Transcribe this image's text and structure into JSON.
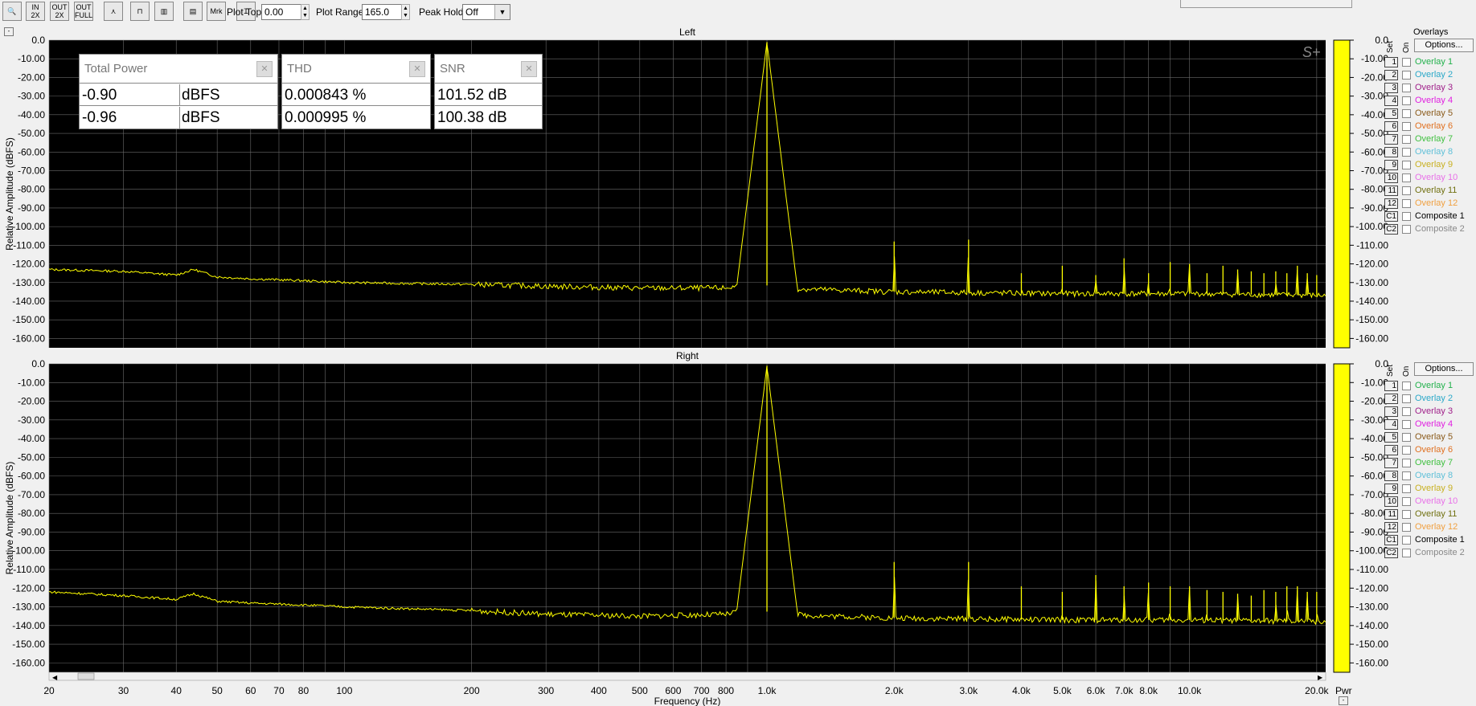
{
  "toolbar": {
    "buttons": [
      {
        "name": "zoom-button",
        "label": "🔍"
      },
      {
        "name": "zoom-in-2x-button",
        "label": "IN 2X"
      },
      {
        "name": "zoom-out-2x-button",
        "label": "OUT 2X"
      },
      {
        "name": "zoom-out-full-button",
        "label": "OUT FULL"
      },
      {
        "name": "line-plot-button",
        "label": "⋏"
      },
      {
        "name": "step-plot-button",
        "label": "⊓"
      },
      {
        "name": "bar-plot-button",
        "label": "▥"
      },
      {
        "name": "display-button",
        "label": "▤"
      },
      {
        "name": "marker-button",
        "label": "Mrk"
      },
      {
        "name": "vertical-scale-button",
        "label": "Ɪ"
      }
    ],
    "plot_top_label": "Plot Top:",
    "plot_top_value": "0.00",
    "plot_range_label": "Plot Range:",
    "plot_range_value": "165.0",
    "peak_hold_label": "Peak Hold:",
    "peak_hold_value": "Off"
  },
  "stats": {
    "total_power": {
      "title": "Total Power",
      "rows": [
        {
          "value": "-0.90",
          "unit": "dBFS"
        },
        {
          "value": "-0.96",
          "unit": "dBFS"
        }
      ]
    },
    "thd": {
      "title": "THD",
      "rows": [
        {
          "value": "0.000843 %"
        },
        {
          "value": "0.000995 %"
        }
      ]
    },
    "snr": {
      "title": "SNR",
      "rows": [
        {
          "value": "101.52 dB"
        },
        {
          "value": "100.38 dB"
        }
      ]
    }
  },
  "logo_text": "S+",
  "meter_label": "Pwr",
  "overlays": {
    "title": "Overlays",
    "set_label": "Set",
    "on_label": "On",
    "options_label": "Options...",
    "items": [
      {
        "set": "1",
        "name": "Overlay 1",
        "color": "#22b14c"
      },
      {
        "set": "2",
        "name": "Overlay 2",
        "color": "#2aa8c8"
      },
      {
        "set": "3",
        "name": "Overlay 3",
        "color": "#a0208a"
      },
      {
        "set": "4",
        "name": "Overlay 4",
        "color": "#e020e0"
      },
      {
        "set": "5",
        "name": "Overlay 5",
        "color": "#8a5a1a"
      },
      {
        "set": "6",
        "name": "Overlay 6",
        "color": "#e07020"
      },
      {
        "set": "7",
        "name": "Overlay 7",
        "color": "#40c040"
      },
      {
        "set": "8",
        "name": "Overlay 8",
        "color": "#60c0d8"
      },
      {
        "set": "9",
        "name": "Overlay 9",
        "color": "#c8b020"
      },
      {
        "set": "10",
        "name": "Overlay 10",
        "color": "#e870e8"
      },
      {
        "set": "11",
        "name": "Overlay 11",
        "color": "#707010"
      },
      {
        "set": "12",
        "name": "Overlay 12",
        "color": "#f0a040"
      },
      {
        "set": "C1",
        "name": "Composite 1",
        "color": "#000000"
      },
      {
        "set": "C2",
        "name": "Composite 2",
        "color": "#888888"
      }
    ]
  },
  "chart_data": [
    {
      "type": "line",
      "title": "Left",
      "xlabel": "Frequency (Hz)",
      "ylabel": "Relative Amplitude (dBFS)",
      "x_scale": "log",
      "xlim": [
        20,
        21000
      ],
      "ylim": [
        -165,
        0
      ],
      "x_ticks": [
        20,
        30,
        40,
        50,
        60,
        70,
        80,
        100,
        200,
        300,
        400,
        500,
        600,
        700,
        800,
        1000,
        2000,
        3000,
        4000,
        5000,
        6000,
        7000,
        8000,
        10000,
        20000
      ],
      "x_tick_labels": [
        "20",
        "30",
        "40",
        "50",
        "60",
        "70",
        "80",
        "100",
        "200",
        "300",
        "400",
        "500",
        "600",
        "700",
        "800",
        "1.0k",
        "2.0k",
        "3.0k",
        "4.0k",
        "5.0k",
        "6.0k",
        "7.0k",
        "8.0k",
        "10.0k",
        "20.0k"
      ],
      "y_ticks": [
        0,
        -10,
        -20,
        -30,
        -40,
        -50,
        -60,
        -70,
        -80,
        -90,
        -100,
        -110,
        -120,
        -130,
        -140,
        -150,
        -160
      ],
      "y_tick_labels": [
        "0.0",
        "-10.00",
        "-20.00",
        "-30.00",
        "-40.00",
        "-50.00",
        "-60.00",
        "-70.00",
        "-80.00",
        "-90.00",
        "-100.00",
        "-110.00",
        "-120.00",
        "-130.00",
        "-140.00",
        "-150.00",
        "-160.00"
      ],
      "grid": true,
      "series": [
        {
          "color": "#ffff00",
          "noise_floor": {
            "x": [
              20,
              30,
              40,
              44,
              50,
              60,
              80,
              100,
              200,
              300,
              500,
              800,
              950,
              1050,
              2000,
              5000,
              10000,
              21000
            ],
            "y": [
              -123,
              -124,
              -126,
              -123,
              -127,
              -128,
              -129,
              -130,
              -131,
              -132,
              -133,
              -133,
              -130,
              -133,
              -135,
              -136,
              -136,
              -137
            ]
          },
          "peaks": {
            "x": [
              1000,
              2000,
              3000,
              4000,
              5000,
              6000,
              7000,
              8000,
              9000,
              10000,
              11000,
              12000,
              13000,
              14000,
              15000,
              16000,
              17000,
              18000,
              19000,
              20000
            ],
            "y": [
              -1,
              -108,
              -107,
              -125,
              -121,
              -126,
              -117,
              -125,
              -119,
              -120,
              -125,
              -121,
              -123,
              -124,
              -125,
              -124,
              -125,
              -121,
              -125,
              -126
            ]
          }
        }
      ]
    },
    {
      "type": "line",
      "title": "Right",
      "xlabel": "Frequency (Hz)",
      "ylabel": "Relative Amplitude (dBFS)",
      "x_scale": "log",
      "xlim": [
        20,
        21000
      ],
      "ylim": [
        -165,
        0
      ],
      "x_ticks": [
        20,
        30,
        40,
        50,
        60,
        70,
        80,
        100,
        200,
        300,
        400,
        500,
        600,
        700,
        800,
        1000,
        2000,
        3000,
        4000,
        5000,
        6000,
        7000,
        8000,
        10000,
        20000
      ],
      "x_tick_labels": [
        "20",
        "30",
        "40",
        "50",
        "60",
        "70",
        "80",
        "100",
        "200",
        "300",
        "400",
        "500",
        "600",
        "700",
        "800",
        "1.0k",
        "2.0k",
        "3.0k",
        "4.0k",
        "5.0k",
        "6.0k",
        "7.0k",
        "8.0k",
        "10.0k",
        "20.0k"
      ],
      "y_ticks": [
        0,
        -10,
        -20,
        -30,
        -40,
        -50,
        -60,
        -70,
        -80,
        -90,
        -100,
        -110,
        -120,
        -130,
        -140,
        -150,
        -160
      ],
      "y_tick_labels": [
        "0.0",
        "-10.00",
        "-20.00",
        "-30.00",
        "-40.00",
        "-50.00",
        "-60.00",
        "-70.00",
        "-80.00",
        "-90.00",
        "-100.00",
        "-110.00",
        "-120.00",
        "-130.00",
        "-140.00",
        "-150.00",
        "-160.00"
      ],
      "grid": true,
      "series": [
        {
          "color": "#ffff00",
          "noise_floor": {
            "x": [
              20,
              30,
              40,
              44,
              50,
              60,
              80,
              100,
              200,
              300,
              500,
              800,
              950,
              1050,
              2000,
              5000,
              10000,
              21000
            ],
            "y": [
              -122,
              -124,
              -126,
              -123,
              -127,
              -128,
              -129,
              -130,
              -132,
              -134,
              -135,
              -134,
              -131,
              -134,
              -136,
              -137,
              -137,
              -138
            ]
          },
          "peaks": {
            "x": [
              1000,
              2000,
              3000,
              4000,
              5000,
              6000,
              7000,
              8000,
              9000,
              10000,
              11000,
              12000,
              13000,
              14000,
              15000,
              16000,
              17000,
              18000,
              19000,
              20000
            ],
            "y": [
              -1,
              -106,
              -106,
              -119,
              -122,
              -113,
              -119,
              -117,
              -119,
              -119,
              -121,
              -122,
              -123,
              -124,
              -121,
              -122,
              -119,
              -119,
              -122,
              -122
            ]
          }
        }
      ]
    }
  ]
}
